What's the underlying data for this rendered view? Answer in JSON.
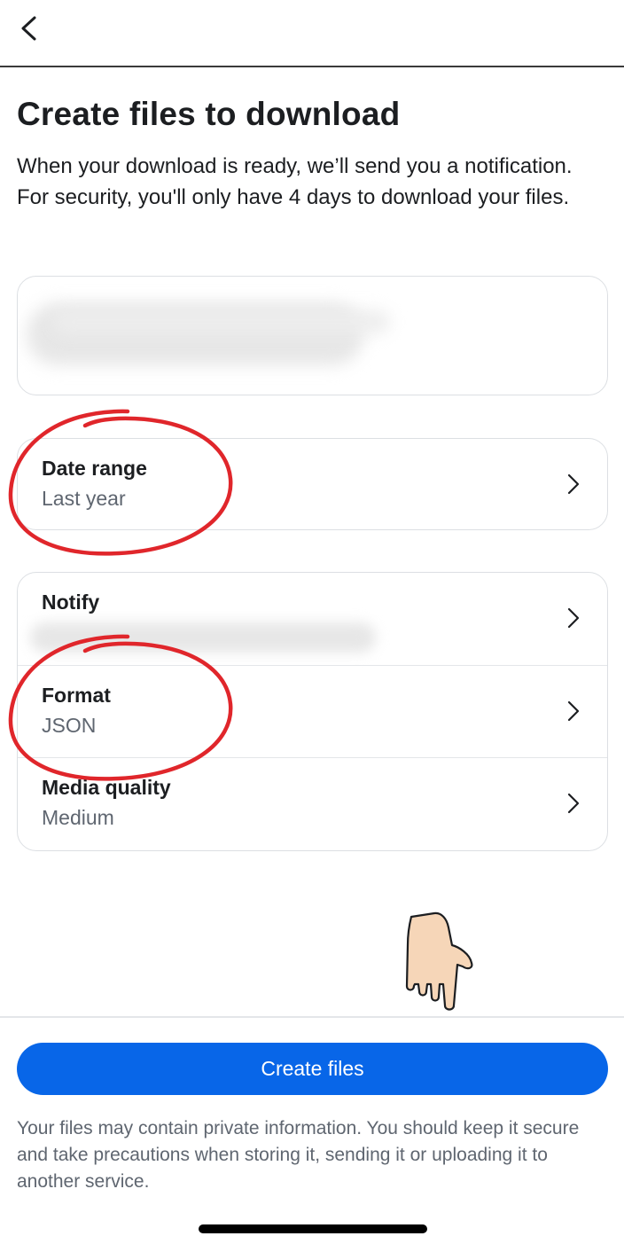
{
  "header": {
    "back_icon": "chevron-left-icon"
  },
  "page": {
    "title": "Create files to download",
    "description": "When your download is ready, we’ll send you a notification. For security, you'll only have 4 days to download your files."
  },
  "date_range": {
    "label": "Date range",
    "value": "Last year"
  },
  "settings": {
    "notify": {
      "label": "Notify"
    },
    "format": {
      "label": "Format",
      "value": "JSON"
    },
    "media_quality": {
      "label": "Media quality",
      "value": "Medium"
    }
  },
  "footer": {
    "create_button": "Create files",
    "note": "Your files may contain private information. You should keep it secure and take precautions when storing it, sending it or uploading it to another service."
  },
  "colors": {
    "primary": "#0866e8",
    "annotation": "#e0262b",
    "secondary_text": "#5f6670"
  }
}
